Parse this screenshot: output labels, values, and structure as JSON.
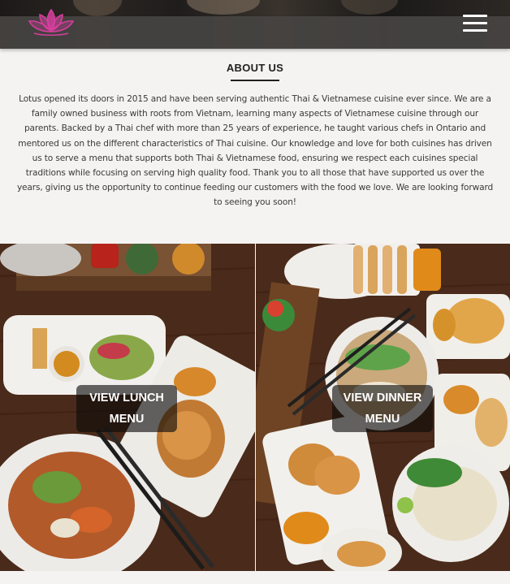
{
  "header": {
    "logo_name": "lotus-logo",
    "menu_icon": "hamburger-icon",
    "colors": {
      "bar": "#464442",
      "logo": "#d43e9c"
    }
  },
  "about": {
    "title": "ABOUT US",
    "body": "Lotus opened its doors in 2015 and have been serving authentic Thai & Vietnamese cuisine ever since. We are a family owned business with roots from Vietnam, learning many aspects of Vietnamese cuisine through our parents. Backed by a Thai chef with more than 25 years of experience, he taught various chefs in Ontario and mentored us on the different characteristics of Thai cuisine. Our knowledge and love for both cuisines has driven us to serve a menu that supports both Thai & Vietnamese food, ensuring we respect each cuisines special traditions while focusing on serving high quality food. Thank you to all those that have supported us over the years, giving us the opportunity to continue feeding our customers with the food we love. We are looking forward to seeing you soon!"
  },
  "menus": {
    "lunch": {
      "line1": "VIEW LUNCH",
      "line2": "MENU"
    },
    "dinner": {
      "line1": "VIEW DINNER",
      "line2": "MENU"
    }
  }
}
